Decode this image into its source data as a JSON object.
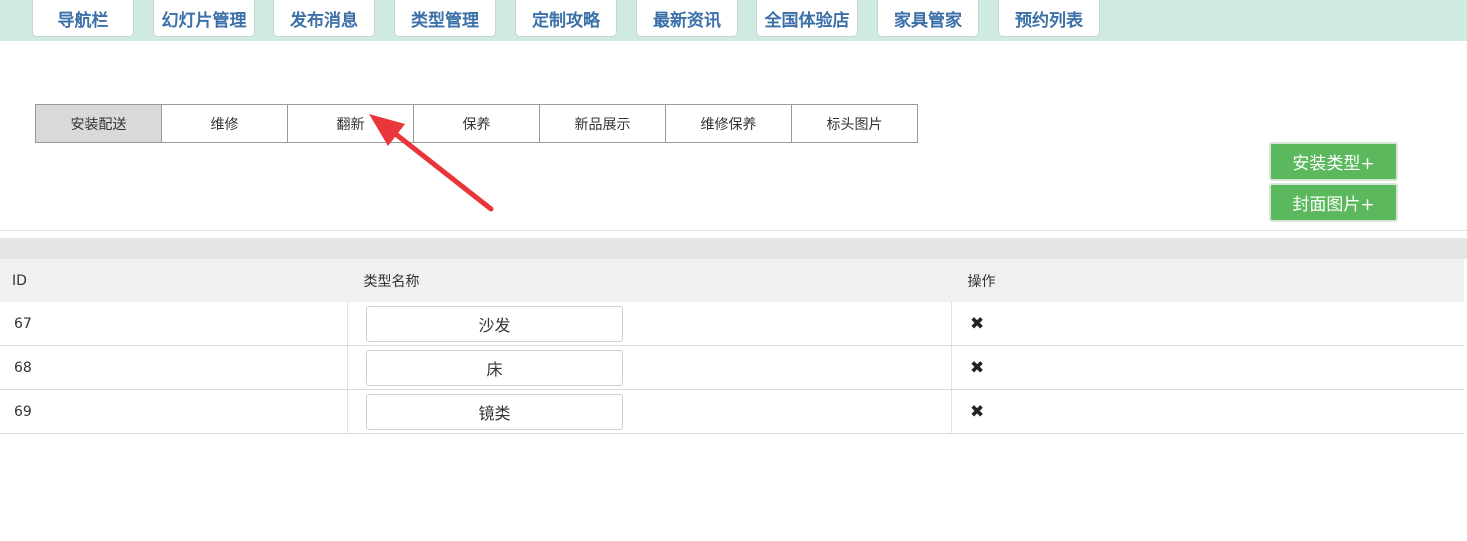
{
  "top_nav": [
    {
      "label": "导航栏"
    },
    {
      "label": "幻灯片管理"
    },
    {
      "label": "发布消息"
    },
    {
      "label": "类型管理"
    },
    {
      "label": "定制攻略"
    },
    {
      "label": "最新资讯"
    },
    {
      "label": "全国体验店"
    },
    {
      "label": "家具管家"
    },
    {
      "label": "预约列表"
    }
  ],
  "sub_tabs": [
    {
      "label": "安装配送",
      "active": true
    },
    {
      "label": "维修"
    },
    {
      "label": "翻新"
    },
    {
      "label": "保养"
    },
    {
      "label": "新品展示"
    },
    {
      "label": "维修保养"
    },
    {
      "label": "标头图片"
    }
  ],
  "buttons": {
    "add_type": "安装类型+",
    "cover_image": "封面图片+"
  },
  "table": {
    "headers": {
      "id": "ID",
      "name": "类型名称",
      "action": "操作"
    },
    "rows": [
      {
        "id": "67",
        "name": "沙发"
      },
      {
        "id": "68",
        "name": "床"
      },
      {
        "id": "69",
        "name": "镜类"
      }
    ],
    "delete_icon": "✖"
  },
  "colors": {
    "nav_bg": "#cfeae1",
    "nav_text": "#3b70a8",
    "green_button": "#5cb85c",
    "annotation_arrow": "#e8363a"
  }
}
